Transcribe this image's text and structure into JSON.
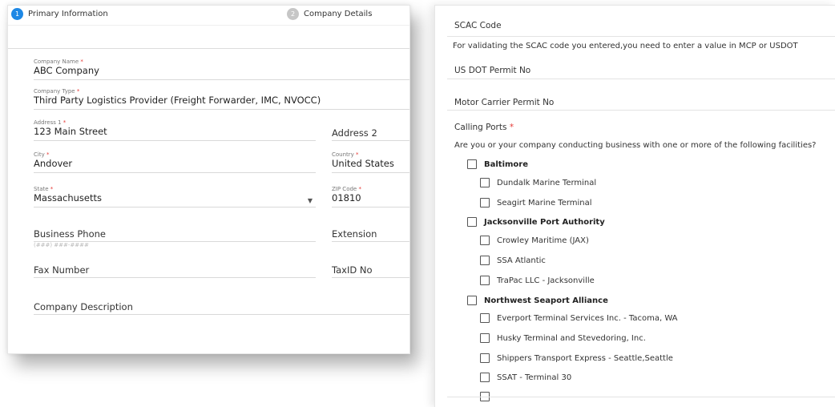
{
  "stepper": {
    "steps": [
      {
        "number": "1",
        "label": "Primary Information"
      },
      {
        "number": "2",
        "label": "Company Details"
      }
    ]
  },
  "form": {
    "company_name": {
      "label": "Company Name",
      "value": "ABC Company"
    },
    "company_type": {
      "label": "Company Type",
      "value": "Third Party Logistics Provider (Freight Forwarder, IMC, NVOCC)"
    },
    "address1": {
      "label": "Address 1",
      "value": "123 Main Street"
    },
    "address2": {
      "placeholder": "Address 2"
    },
    "city": {
      "label": "City",
      "value": "Andover"
    },
    "country": {
      "label": "Country",
      "value": "United States"
    },
    "state": {
      "label": "State",
      "value": "Massachusetts"
    },
    "zip": {
      "label": "ZIP Code",
      "value": "01810"
    },
    "business_phone": {
      "placeholder": "Business Phone",
      "hint": "(###) ###-####"
    },
    "extension": {
      "placeholder": "Extension"
    },
    "fax": {
      "placeholder": "Fax Number"
    },
    "taxid": {
      "placeholder": "TaxID No"
    },
    "description": {
      "placeholder": "Company Description"
    },
    "required_mark": "*"
  },
  "right": {
    "scac_label": "SCAC Code",
    "scac_note": "For validating the SCAC code you entered,you need to enter a value in MCP or USDOT",
    "usdot_label": "US DOT Permit No",
    "mcp_label": "Motor Carrier Permit No",
    "calling_ports_label": "Calling Ports",
    "question": "Are you or your company conducting business with one or more of the following facilities?",
    "groups": [
      {
        "name": "Baltimore",
        "items": [
          "Dundalk Marine Terminal",
          "Seagirt Marine Terminal"
        ]
      },
      {
        "name": "Jacksonville Port Authority",
        "items": [
          "Crowley Maritime (JAX)",
          "SSA Atlantic",
          "TraPac LLC - Jacksonville"
        ]
      },
      {
        "name": "Northwest Seaport Alliance",
        "items": [
          "Everport Terminal Services Inc. - Tacoma, WA",
          "Husky Terminal and Stevedoring, Inc.",
          "Shippers Transport Express - Seattle,Seattle",
          "SSAT - Terminal 30"
        ]
      }
    ]
  }
}
